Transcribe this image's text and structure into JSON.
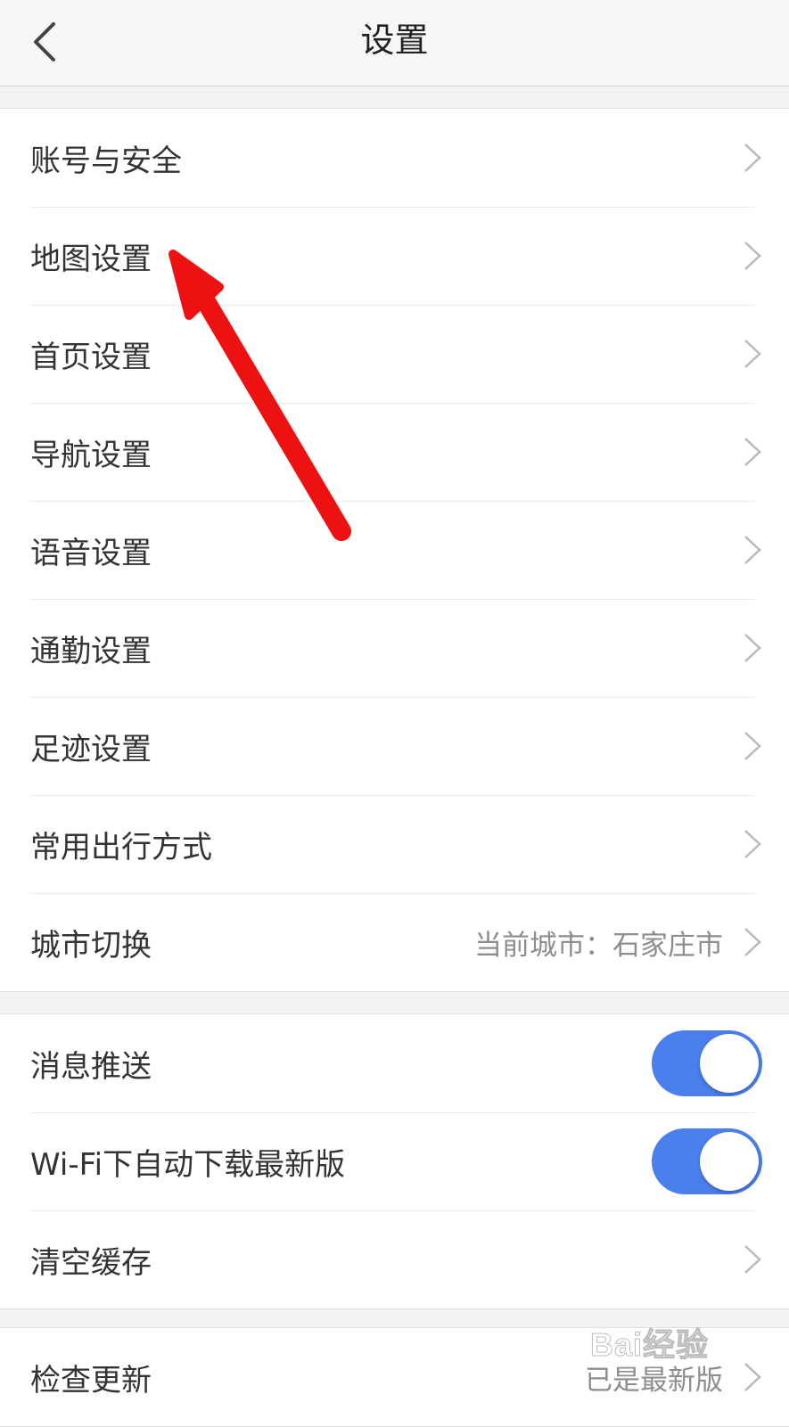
{
  "header": {
    "title": "设置"
  },
  "icons": {
    "back": "chevron-left-icon",
    "row_chevron": "chevron-right-icon"
  },
  "colors": {
    "toggle_on": "#4a7fec",
    "annotation_arrow": "#ee1111",
    "value_text": "#8d8d90"
  },
  "group1": {
    "items": [
      {
        "label": "账号与安全"
      },
      {
        "label": "地图设置"
      },
      {
        "label": "首页设置"
      },
      {
        "label": "导航设置"
      },
      {
        "label": "语音设置"
      },
      {
        "label": "通勤设置"
      },
      {
        "label": "足迹设置"
      },
      {
        "label": "常用出行方式"
      },
      {
        "label": "城市切换",
        "value": "当前城市：石家庄市"
      }
    ]
  },
  "group2": {
    "items": [
      {
        "label": "消息推送",
        "toggle": true
      },
      {
        "label": "Wi-Fi下自动下载最新版",
        "toggle": true
      },
      {
        "label": "清空缓存"
      }
    ]
  },
  "group3": {
    "items": [
      {
        "label": "检查更新",
        "value": "已是最新版"
      }
    ]
  },
  "annotation": {
    "type": "red-arrow",
    "points_to": "地图设置"
  },
  "watermark": {
    "text": "Bai经验"
  }
}
